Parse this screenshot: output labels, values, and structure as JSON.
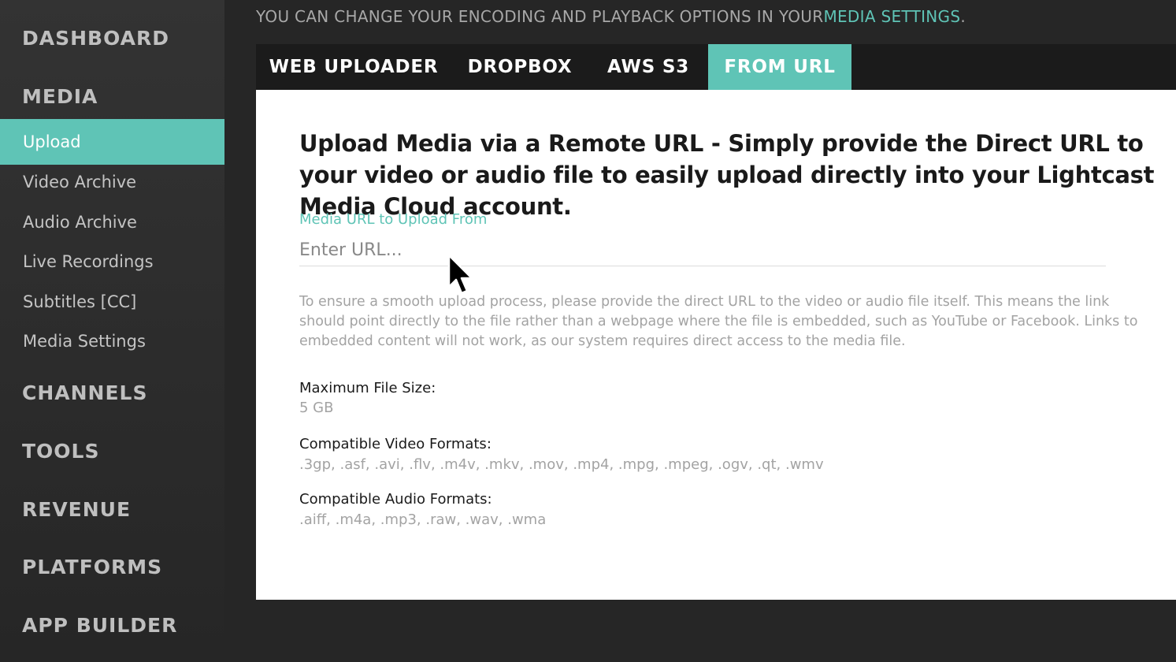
{
  "sidebar": {
    "sections": [
      {
        "label": "DASHBOARD"
      },
      {
        "label": "MEDIA"
      },
      {
        "label": "CHANNELS"
      },
      {
        "label": "TOOLS"
      },
      {
        "label": "REVENUE"
      },
      {
        "label": "PLATFORMS"
      },
      {
        "label": "APP BUILDER"
      }
    ],
    "media_items": [
      {
        "label": "Upload",
        "active": true
      },
      {
        "label": "Video Archive"
      },
      {
        "label": "Audio Archive"
      },
      {
        "label": "Live Recordings"
      },
      {
        "label": "Subtitles [CC]"
      },
      {
        "label": "Media Settings"
      }
    ]
  },
  "banner": {
    "text": "YOU CAN CHANGE YOUR ENCODING AND PLAYBACK OPTIONS IN YOUR ",
    "link": "MEDIA SETTINGS",
    "suffix": "."
  },
  "tabs": [
    {
      "label": "WEB UPLOADER"
    },
    {
      "label": "DROPBOX"
    },
    {
      "label": "AWS S3"
    },
    {
      "label": "FROM URL",
      "active": true
    }
  ],
  "main": {
    "heading": "Upload Media via a Remote URL - Simply provide the Direct URL to your video or audio file to easily upload directly into your Lightcast Media Cloud account.",
    "url_label": "Media URL to Upload From",
    "url_placeholder": "Enter URL...",
    "help_text": "To ensure a smooth upload process, please provide the direct URL to the video or audio file itself. This means the link should point directly to the file rather than a webpage where the file is embedded, such as YouTube or Facebook. Links to embedded content will not work, as our system requires direct access to the media file.",
    "max_size_label": "Maximum File Size:",
    "max_size_value": "5 GB",
    "video_formats_label": "Compatible Video Formats:",
    "video_formats_value": ".3gp, .asf, .avi, .flv, .m4v, .mkv, .mov, .mp4, .mpg, .mpeg, .ogv, .qt, .wmv",
    "audio_formats_label": "Compatible Audio Formats:",
    "audio_formats_value": ".aiff, .m4a, .mp3, .raw, .wav, .wma"
  },
  "colors": {
    "accent": "#5fc4b6",
    "sidebar_bg": "#2e2e2e",
    "tabbar_bg": "#1b1b1b"
  }
}
